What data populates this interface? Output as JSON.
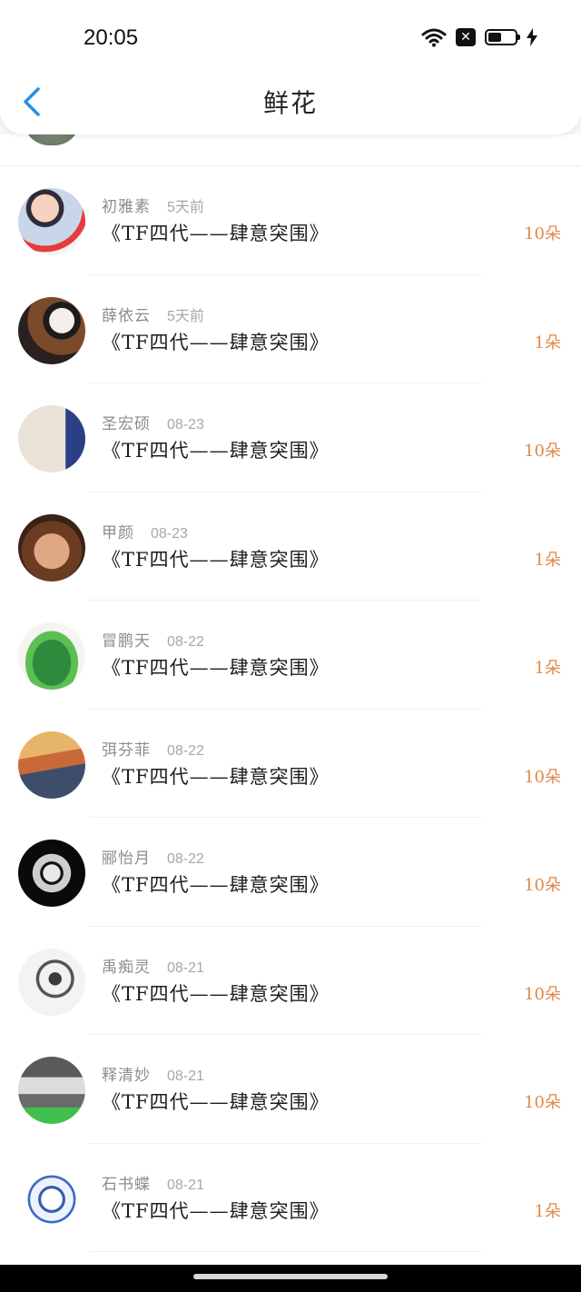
{
  "status_bar": {
    "time": "20:05"
  },
  "header": {
    "title": "鲜花"
  },
  "rows": [
    {
      "name": "初雅素",
      "date": "5天前",
      "message": "《TF四代——肆意突围》",
      "amount": "10朵"
    },
    {
      "name": "薛依云",
      "date": "5天前",
      "message": "《TF四代——肆意突围》",
      "amount": "1朵"
    },
    {
      "name": "圣宏硕",
      "date": "08-23",
      "message": "《TF四代——肆意突围》",
      "amount": "10朵"
    },
    {
      "name": "甲颜",
      "date": "08-23",
      "message": "《TF四代——肆意突围》",
      "amount": "1朵"
    },
    {
      "name": "冒鹏天",
      "date": "08-22",
      "message": "《TF四代——肆意突围》",
      "amount": "1朵"
    },
    {
      "name": "弭芬菲",
      "date": "08-22",
      "message": "《TF四代——肆意突围》",
      "amount": "10朵"
    },
    {
      "name": "郦怡月",
      "date": "08-22",
      "message": "《TF四代——肆意突围》",
      "amount": "10朵"
    },
    {
      "name": "禹痴灵",
      "date": "08-21",
      "message": "《TF四代——肆意突围》",
      "amount": "10朵"
    },
    {
      "name": "释清妙",
      "date": "08-21",
      "message": "《TF四代——肆意突围》",
      "amount": "10朵"
    },
    {
      "name": "石书蝶",
      "date": "08-21",
      "message": "《TF四代——肆意突围》",
      "amount": "1朵"
    }
  ],
  "colors": {
    "accent": "#2a8ee6",
    "amount": "#e0884a"
  }
}
